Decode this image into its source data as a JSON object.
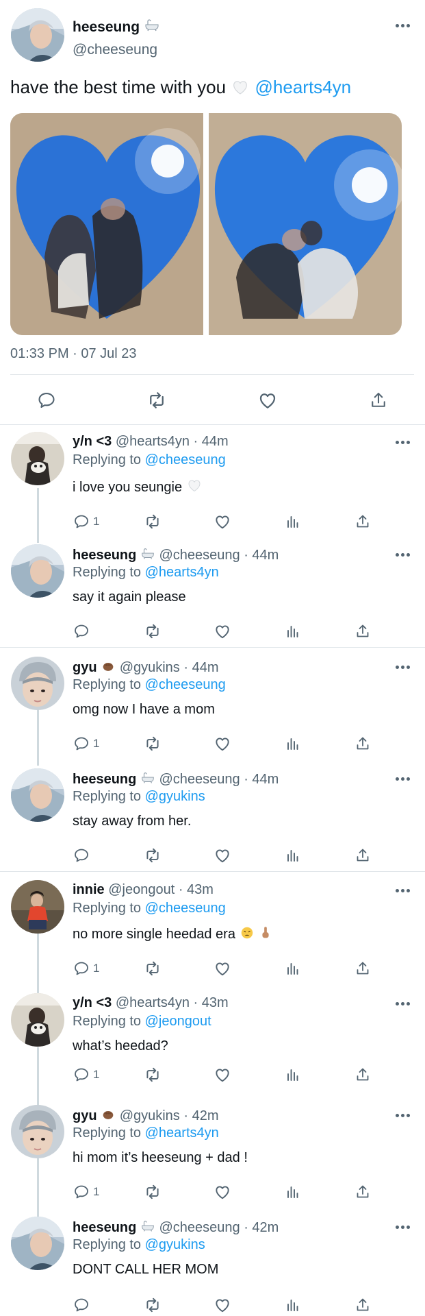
{
  "main": {
    "name": "heeseung",
    "handle": "@cheeseung",
    "text": "have the best time with you",
    "mention": "@hearts4yn",
    "timestamp": "01:33 PM · 07 Jul 23"
  },
  "replies": [
    {
      "name": "y/n <3",
      "meta": "@hearts4yn · 44m",
      "replying_label": "Replying to",
      "replying_to": "@cheeseung",
      "body": "i love you seungie",
      "reply_count": "1"
    },
    {
      "name": "heeseung",
      "meta": "@cheeseung · 44m",
      "replying_label": "Replying to",
      "replying_to": "@hearts4yn",
      "body": "say it again please",
      "reply_count": ""
    },
    {
      "name": "gyu",
      "meta": "@gyukins · 44m",
      "replying_label": "Replying to",
      "replying_to": "@cheeseung",
      "body": "omg now I have a mom",
      "reply_count": "1"
    },
    {
      "name": "heeseung",
      "meta": "@cheeseung · 44m",
      "replying_label": "Replying to",
      "replying_to": "@gyukins",
      "body": "stay away from her.",
      "reply_count": ""
    },
    {
      "name": "innie",
      "meta": "@jeongout · 43m",
      "replying_label": "Replying to",
      "replying_to": "@cheeseung",
      "body": "no more single heedad era",
      "reply_count": "1"
    },
    {
      "name": "y/n <3",
      "meta": "@hearts4yn · 43m",
      "replying_label": "Replying to",
      "replying_to": "@jeongout",
      "body": "what’s heedad?",
      "reply_count": "1"
    },
    {
      "name": "gyu",
      "meta": "@gyukins · 42m",
      "replying_label": "Replying to",
      "replying_to": "@hearts4yn",
      "body": "hi mom it’s heeseung + dad !",
      "reply_count": "1"
    },
    {
      "name": "heeseung",
      "meta": "@cheeseung · 42m",
      "replying_label": "Replying to",
      "replying_to": "@gyukins",
      "body": "DONT CALL HER MOM",
      "reply_count": ""
    }
  ],
  "colors": {
    "accent": "#1d9bf0",
    "secondary_text": "#536471",
    "divider": "#e1e6ea"
  }
}
